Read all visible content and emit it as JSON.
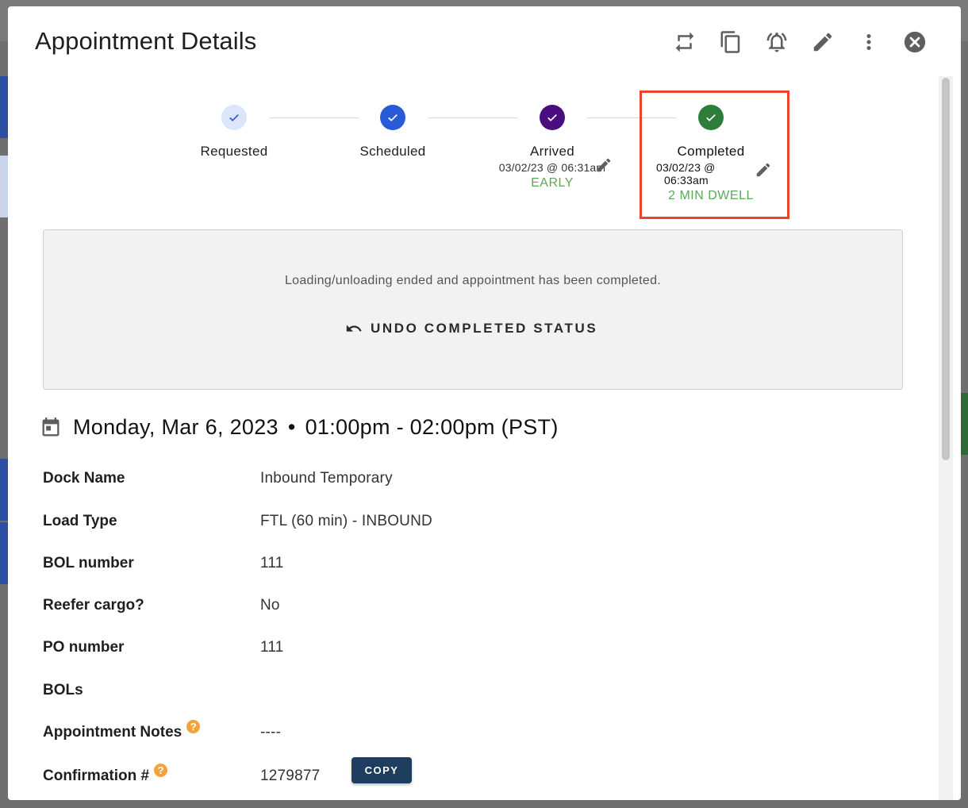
{
  "modal": {
    "title": "Appointment Details",
    "actions": [
      {
        "name": "reschedule-icon"
      },
      {
        "name": "duplicate-icon"
      },
      {
        "name": "notification-bell-icon"
      },
      {
        "name": "edit-pencil-icon"
      },
      {
        "name": "more-vert-icon"
      },
      {
        "name": "close-circle-icon"
      }
    ]
  },
  "status_steps": [
    {
      "label": "Requested",
      "color": "#dbe6fb",
      "check_color": "#2a5bd7"
    },
    {
      "label": "Scheduled",
      "color": "#2a5bd7",
      "check_color": "#ffffff"
    },
    {
      "label": "Arrived",
      "color": "#4b0e7f",
      "check_color": "#ffffff",
      "timestamp": "03/02/23 @ 06:31am",
      "tag": "EARLY"
    },
    {
      "label": "Completed",
      "color": "#2f7d3a",
      "check_color": "#ffffff",
      "timestamp_line1": "03/02/23 @",
      "timestamp_line2": "06:33am",
      "tag": "2 MIN DWELL"
    }
  ],
  "banner": {
    "message": "Loading/unloading ended and appointment has been completed.",
    "undo_label": "UNDO COMPLETED STATUS"
  },
  "schedule": {
    "date": "Monday, Mar 6, 2023",
    "separator": "•",
    "time": "01:00pm - 02:00pm (PST)"
  },
  "details": [
    {
      "label": "Dock Name",
      "value": "Inbound Temporary"
    },
    {
      "label": "Load Type",
      "value": "FTL (60 min) - INBOUND"
    },
    {
      "label": "BOL number",
      "value": "111"
    },
    {
      "label": "Reefer cargo?",
      "value": "No"
    },
    {
      "label": "PO number",
      "value": "111"
    },
    {
      "label": "BOLs",
      "value": ""
    },
    {
      "label": "Appointment Notes",
      "value": "----",
      "help": "?"
    },
    {
      "label": "Confirmation #",
      "value": "1279877",
      "help": "?",
      "copy_label": "COPY"
    }
  ]
}
